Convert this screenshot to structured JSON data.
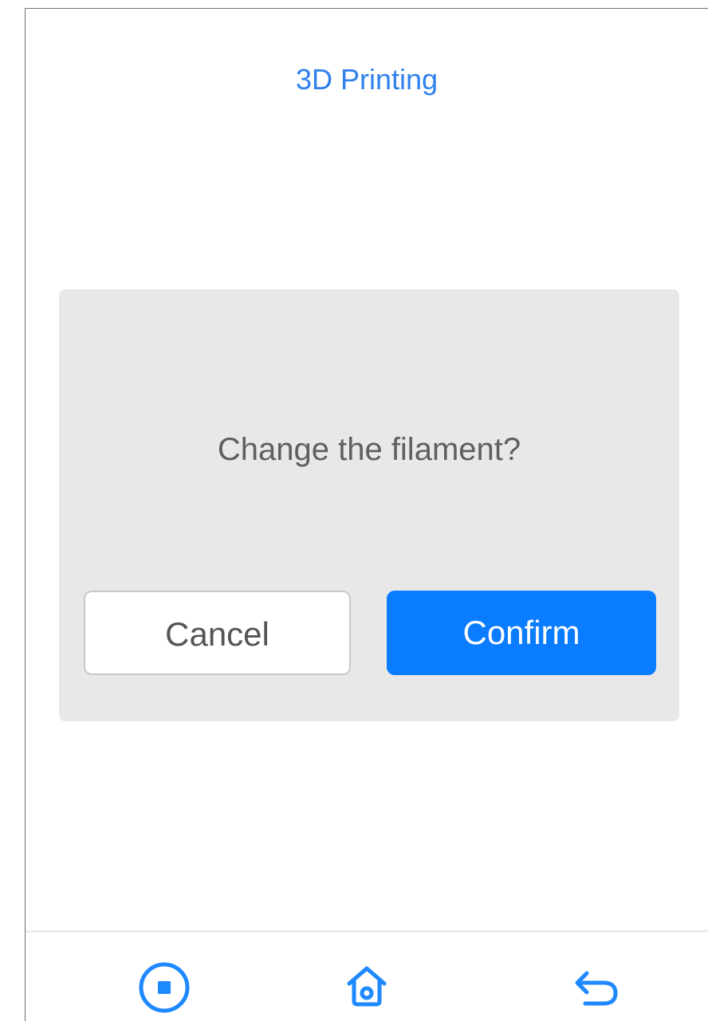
{
  "header": {
    "title": "3D Printing"
  },
  "dialog": {
    "message": "Change the filament?",
    "cancel_label": "Cancel",
    "confirm_label": "Confirm"
  },
  "bottom_nav": [
    {
      "icon": "stop-icon"
    },
    {
      "icon": "home-icon"
    },
    {
      "icon": "back-icon"
    }
  ],
  "colors": {
    "accent": "#2f80ed",
    "confirm_button": "#0a7cff",
    "dialog_background": "#e8e8e8",
    "message_text": "#5f5f5f"
  }
}
